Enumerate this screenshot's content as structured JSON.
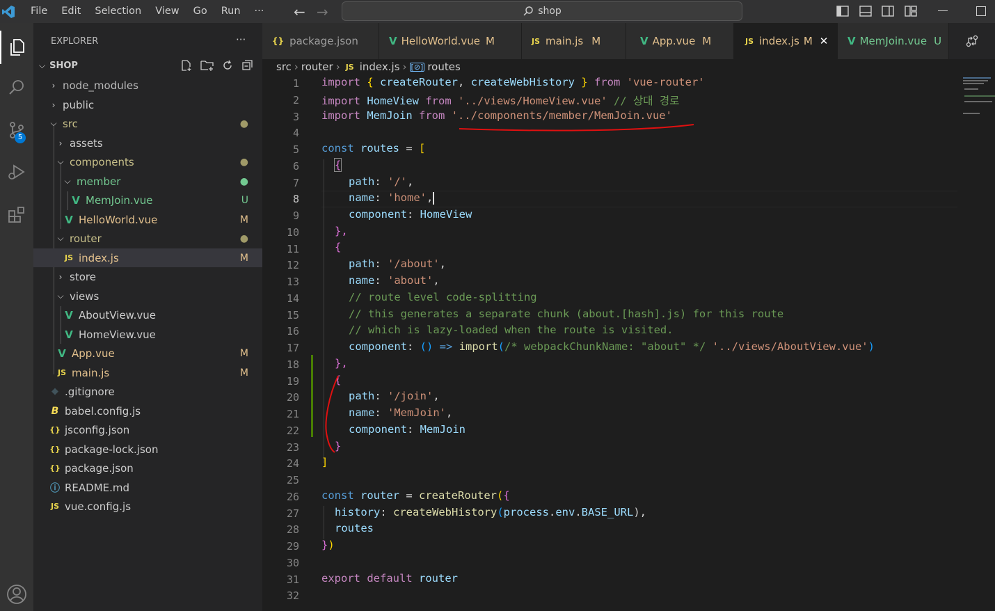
{
  "menu": [
    "File",
    "Edit",
    "Selection",
    "View",
    "Go",
    "Run",
    "···"
  ],
  "search": {
    "text": "shop"
  },
  "activity": {
    "scm_badge": "5"
  },
  "explorer": {
    "title": "EXPLORER",
    "more": "···",
    "folder": "SHOP",
    "items": [
      {
        "label": "node_modules",
        "badge": ""
      },
      {
        "label": "public",
        "badge": ""
      },
      {
        "label": "src",
        "badge": "●"
      },
      {
        "label": "assets",
        "badge": ""
      },
      {
        "label": "components",
        "badge": "●"
      },
      {
        "label": "member",
        "badge": "●"
      },
      {
        "label": "MemJoin.vue",
        "badge": "U"
      },
      {
        "label": "HelloWorld.vue",
        "badge": "M"
      },
      {
        "label": "router",
        "badge": "●"
      },
      {
        "label": "index.js",
        "badge": "M"
      },
      {
        "label": "store",
        "badge": ""
      },
      {
        "label": "views",
        "badge": ""
      },
      {
        "label": "AboutView.vue",
        "badge": ""
      },
      {
        "label": "HomeView.vue",
        "badge": ""
      },
      {
        "label": "App.vue",
        "badge": "M"
      },
      {
        "label": "main.js",
        "badge": "M"
      },
      {
        "label": ".gitignore",
        "badge": ""
      },
      {
        "label": "babel.config.js",
        "badge": ""
      },
      {
        "label": "jsconfig.json",
        "badge": ""
      },
      {
        "label": "package-lock.json",
        "badge": ""
      },
      {
        "label": "package.json",
        "badge": ""
      },
      {
        "label": "README.md",
        "badge": ""
      },
      {
        "label": "vue.config.js",
        "badge": ""
      }
    ]
  },
  "tabs": [
    {
      "label": "package.json",
      "mod": ""
    },
    {
      "label": "HelloWorld.vue",
      "mod": "M"
    },
    {
      "label": "main.js",
      "mod": "M"
    },
    {
      "label": "App.vue",
      "mod": "M"
    },
    {
      "label": "index.js",
      "mod": "M"
    },
    {
      "label": "MemJoin.vue",
      "mod": "U"
    }
  ],
  "breadcrumb": {
    "a": "src",
    "b": "router",
    "c": "index.js",
    "d": "routes"
  },
  "icons": {
    "js": "JS",
    "json": "{}",
    "vue": "V",
    "close": "✕",
    "info": "ⓘ",
    "diamond": "◆",
    "babel": "B"
  },
  "lines": [
    "1",
    "2",
    "3",
    "4",
    "5",
    "6",
    "7",
    "8",
    "9",
    "10",
    "11",
    "12",
    "13",
    "14",
    "15",
    "16",
    "17",
    "18",
    "19",
    "20",
    "21",
    "22",
    "23",
    "24",
    "25",
    "26",
    "27",
    "28",
    "29",
    "30",
    "31",
    "32"
  ],
  "code": {
    "l1": [
      "import",
      " { ",
      "createRouter",
      ", ",
      "createWebHistory",
      " } ",
      "from",
      " ",
      "'vue-router'"
    ],
    "l2": [
      "import",
      " ",
      "HomeView",
      " ",
      "from",
      " ",
      "'../views/HomeView.vue'",
      " // 상대 경로"
    ],
    "l3": [
      "import",
      " ",
      "MemJoin",
      " ",
      "from",
      " ",
      "'../components/member/MemJoin.vue'"
    ],
    "l5": [
      "const",
      " ",
      "routes",
      " = ",
      "["
    ],
    "l6": "{",
    "l7": [
      "path",
      ": ",
      "'/'",
      ","
    ],
    "l8": [
      "name",
      ": ",
      "'home'",
      ","
    ],
    "l9": [
      "component",
      ": ",
      "HomeView"
    ],
    "l10": "},",
    "l11": "{",
    "l12": [
      "path",
      ": ",
      "'/about'",
      ","
    ],
    "l13": [
      "name",
      ": ",
      "'about'",
      ","
    ],
    "l14": "// route level code-splitting",
    "l15": "// this generates a separate chunk (about.[hash].js) for this route",
    "l16": "// which is lazy-loaded when the route is visited.",
    "l17": [
      "component",
      ": ",
      "()",
      " => ",
      "import",
      "(",
      "/* webpackChunkName: \"about\" */",
      " ",
      "'../views/AboutView.vue'",
      ")"
    ],
    "l18": "},",
    "l19": "{",
    "l20": [
      "path",
      ": ",
      "'/join'",
      ","
    ],
    "l21": [
      "name",
      ": ",
      "'MemJoin'",
      ","
    ],
    "l22": [
      "component",
      ": ",
      "MemJoin"
    ],
    "l23": "}",
    "l24": "]",
    "l26": [
      "const",
      " ",
      "router",
      " = ",
      "createRouter",
      "(",
      "{"
    ],
    "l27": [
      "history",
      ": ",
      "createWebHistory",
      "(",
      "process",
      ".",
      "env",
      ".",
      "BASE_URL",
      "),"
    ],
    "l28": "routes",
    "l29": [
      "}",
      ")"
    ],
    "l31": [
      "export",
      " ",
      "default",
      " ",
      "router"
    ]
  }
}
